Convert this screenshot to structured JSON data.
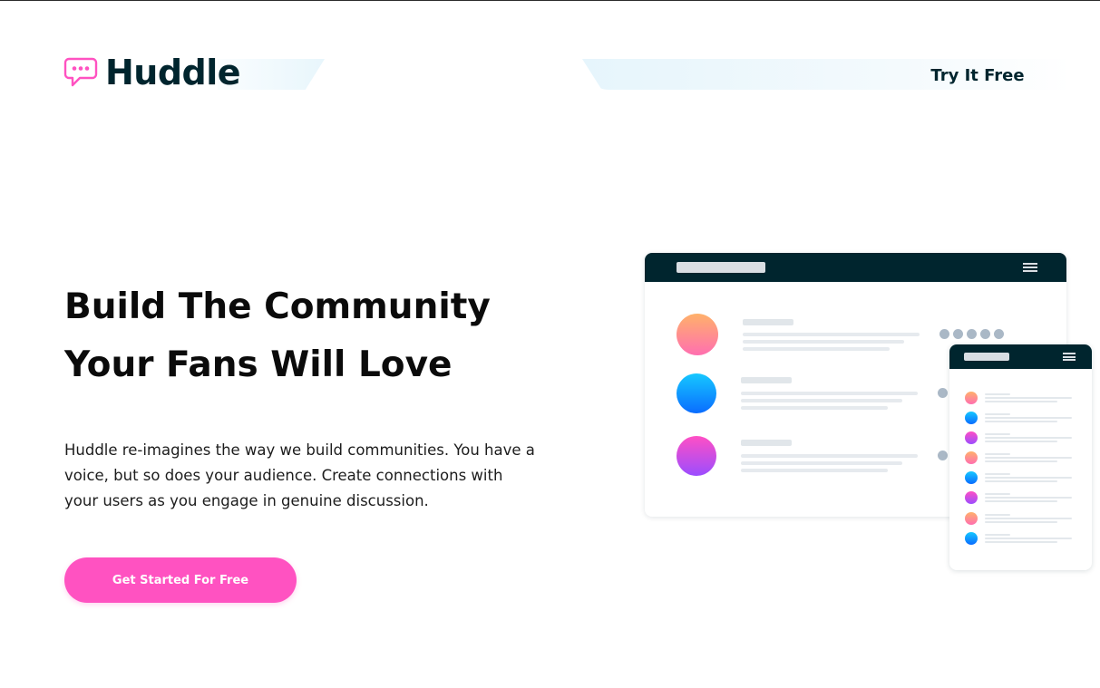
{
  "header": {
    "brand": "Huddle",
    "cta_label": "Try It Free"
  },
  "hero": {
    "title_line_1": "Build The Community",
    "title_line_2": "Your Fans Will Love",
    "description": "Huddle re-imagines the way we build communities. You have a voice, but so does your audience. Create connections with your users as you engage in genuine discussion.",
    "button_label": "Get Started For Free"
  },
  "colors": {
    "primary_dark": "#00252e",
    "accent_pink": "#ff52c1",
    "light_blue": "#e6f5fc"
  },
  "icons": {
    "logo": "speech-bubble-icon",
    "menu": "hamburger-menu-icon"
  }
}
